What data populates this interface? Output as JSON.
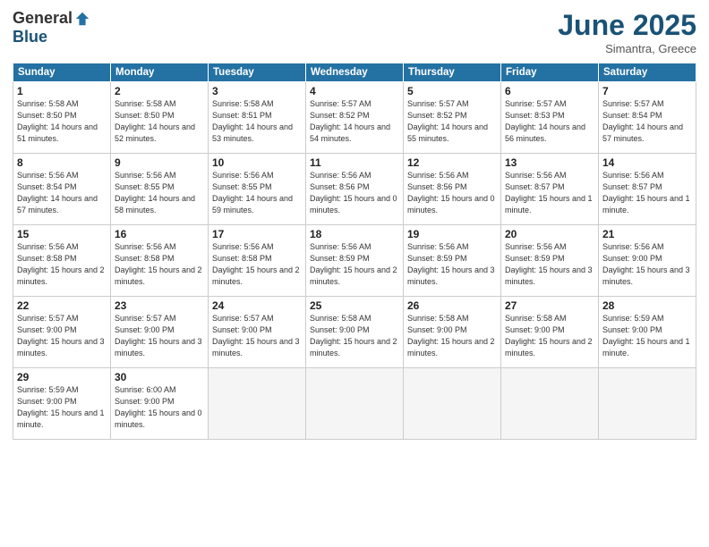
{
  "logo": {
    "general": "General",
    "blue": "Blue"
  },
  "title": "June 2025",
  "location": "Simantra, Greece",
  "headers": [
    "Sunday",
    "Monday",
    "Tuesday",
    "Wednesday",
    "Thursday",
    "Friday",
    "Saturday"
  ],
  "days": [
    {
      "num": "",
      "info": ""
    },
    {
      "num": "",
      "info": ""
    },
    {
      "num": "",
      "info": ""
    },
    {
      "num": "",
      "info": ""
    },
    {
      "num": "",
      "info": ""
    },
    {
      "num": "",
      "info": ""
    },
    {
      "num": "",
      "info": ""
    },
    {
      "num": "1",
      "sunrise": "5:58 AM",
      "sunset": "8:50 PM",
      "daylight": "14 hours and 51 minutes."
    },
    {
      "num": "2",
      "sunrise": "5:58 AM",
      "sunset": "8:50 PM",
      "daylight": "14 hours and 52 minutes."
    },
    {
      "num": "3",
      "sunrise": "5:58 AM",
      "sunset": "8:51 PM",
      "daylight": "14 hours and 53 minutes."
    },
    {
      "num": "4",
      "sunrise": "5:57 AM",
      "sunset": "8:52 PM",
      "daylight": "14 hours and 54 minutes."
    },
    {
      "num": "5",
      "sunrise": "5:57 AM",
      "sunset": "8:52 PM",
      "daylight": "14 hours and 55 minutes."
    },
    {
      "num": "6",
      "sunrise": "5:57 AM",
      "sunset": "8:53 PM",
      "daylight": "14 hours and 56 minutes."
    },
    {
      "num": "7",
      "sunrise": "5:57 AM",
      "sunset": "8:54 PM",
      "daylight": "14 hours and 57 minutes."
    },
    {
      "num": "8",
      "sunrise": "5:56 AM",
      "sunset": "8:54 PM",
      "daylight": "14 hours and 57 minutes."
    },
    {
      "num": "9",
      "sunrise": "5:56 AM",
      "sunset": "8:55 PM",
      "daylight": "14 hours and 58 minutes."
    },
    {
      "num": "10",
      "sunrise": "5:56 AM",
      "sunset": "8:55 PM",
      "daylight": "14 hours and 59 minutes."
    },
    {
      "num": "11",
      "sunrise": "5:56 AM",
      "sunset": "8:56 PM",
      "daylight": "15 hours and 0 minutes."
    },
    {
      "num": "12",
      "sunrise": "5:56 AM",
      "sunset": "8:56 PM",
      "daylight": "15 hours and 0 minutes."
    },
    {
      "num": "13",
      "sunrise": "5:56 AM",
      "sunset": "8:57 PM",
      "daylight": "15 hours and 1 minute."
    },
    {
      "num": "14",
      "sunrise": "5:56 AM",
      "sunset": "8:57 PM",
      "daylight": "15 hours and 1 minute."
    },
    {
      "num": "15",
      "sunrise": "5:56 AM",
      "sunset": "8:58 PM",
      "daylight": "15 hours and 2 minutes."
    },
    {
      "num": "16",
      "sunrise": "5:56 AM",
      "sunset": "8:58 PM",
      "daylight": "15 hours and 2 minutes."
    },
    {
      "num": "17",
      "sunrise": "5:56 AM",
      "sunset": "8:58 PM",
      "daylight": "15 hours and 2 minutes."
    },
    {
      "num": "18",
      "sunrise": "5:56 AM",
      "sunset": "8:59 PM",
      "daylight": "15 hours and 2 minutes."
    },
    {
      "num": "19",
      "sunrise": "5:56 AM",
      "sunset": "8:59 PM",
      "daylight": "15 hours and 3 minutes."
    },
    {
      "num": "20",
      "sunrise": "5:56 AM",
      "sunset": "8:59 PM",
      "daylight": "15 hours and 3 minutes."
    },
    {
      "num": "21",
      "sunrise": "5:56 AM",
      "sunset": "9:00 PM",
      "daylight": "15 hours and 3 minutes."
    },
    {
      "num": "22",
      "sunrise": "5:57 AM",
      "sunset": "9:00 PM",
      "daylight": "15 hours and 3 minutes."
    },
    {
      "num": "23",
      "sunrise": "5:57 AM",
      "sunset": "9:00 PM",
      "daylight": "15 hours and 3 minutes."
    },
    {
      "num": "24",
      "sunrise": "5:57 AM",
      "sunset": "9:00 PM",
      "daylight": "15 hours and 3 minutes."
    },
    {
      "num": "25",
      "sunrise": "5:58 AM",
      "sunset": "9:00 PM",
      "daylight": "15 hours and 2 minutes."
    },
    {
      "num": "26",
      "sunrise": "5:58 AM",
      "sunset": "9:00 PM",
      "daylight": "15 hours and 2 minutes."
    },
    {
      "num": "27",
      "sunrise": "5:58 AM",
      "sunset": "9:00 PM",
      "daylight": "15 hours and 2 minutes."
    },
    {
      "num": "28",
      "sunrise": "5:59 AM",
      "sunset": "9:00 PM",
      "daylight": "15 hours and 1 minute."
    },
    {
      "num": "29",
      "sunrise": "5:59 AM",
      "sunset": "9:00 PM",
      "daylight": "15 hours and 1 minute."
    },
    {
      "num": "30",
      "sunrise": "6:00 AM",
      "sunset": "9:00 PM",
      "daylight": "15 hours and 0 minutes."
    },
    {
      "num": "",
      "info": ""
    },
    {
      "num": "",
      "info": ""
    },
    {
      "num": "",
      "info": ""
    },
    {
      "num": "",
      "info": ""
    },
    {
      "num": "",
      "info": ""
    }
  ]
}
